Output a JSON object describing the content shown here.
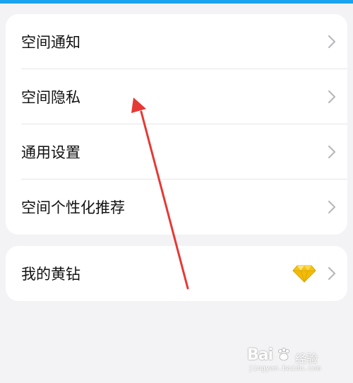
{
  "colors": {
    "top_bar": "#1aa3ee",
    "background": "#f3f3f5",
    "card": "#ffffff",
    "text": "#111111",
    "chevron": "#b8b8bd",
    "diamond": "#f5c314",
    "arrow": "#e53935"
  },
  "settings_group": {
    "items": [
      {
        "label": "空间通知",
        "icon": "chevron-right-icon"
      },
      {
        "label": "空间隐私",
        "icon": "chevron-right-icon"
      },
      {
        "label": "通用设置",
        "icon": "chevron-right-icon"
      },
      {
        "label": "空间个性化推荐",
        "icon": "chevron-right-icon"
      }
    ]
  },
  "vip_group": {
    "item": {
      "label": "我的黄钻",
      "badge_icon": "yellow-diamond-icon",
      "icon": "chevron-right-icon"
    }
  },
  "watermark": {
    "brand": "Bai",
    "sub": "经验",
    "url": "jingyan.baidu.com"
  }
}
